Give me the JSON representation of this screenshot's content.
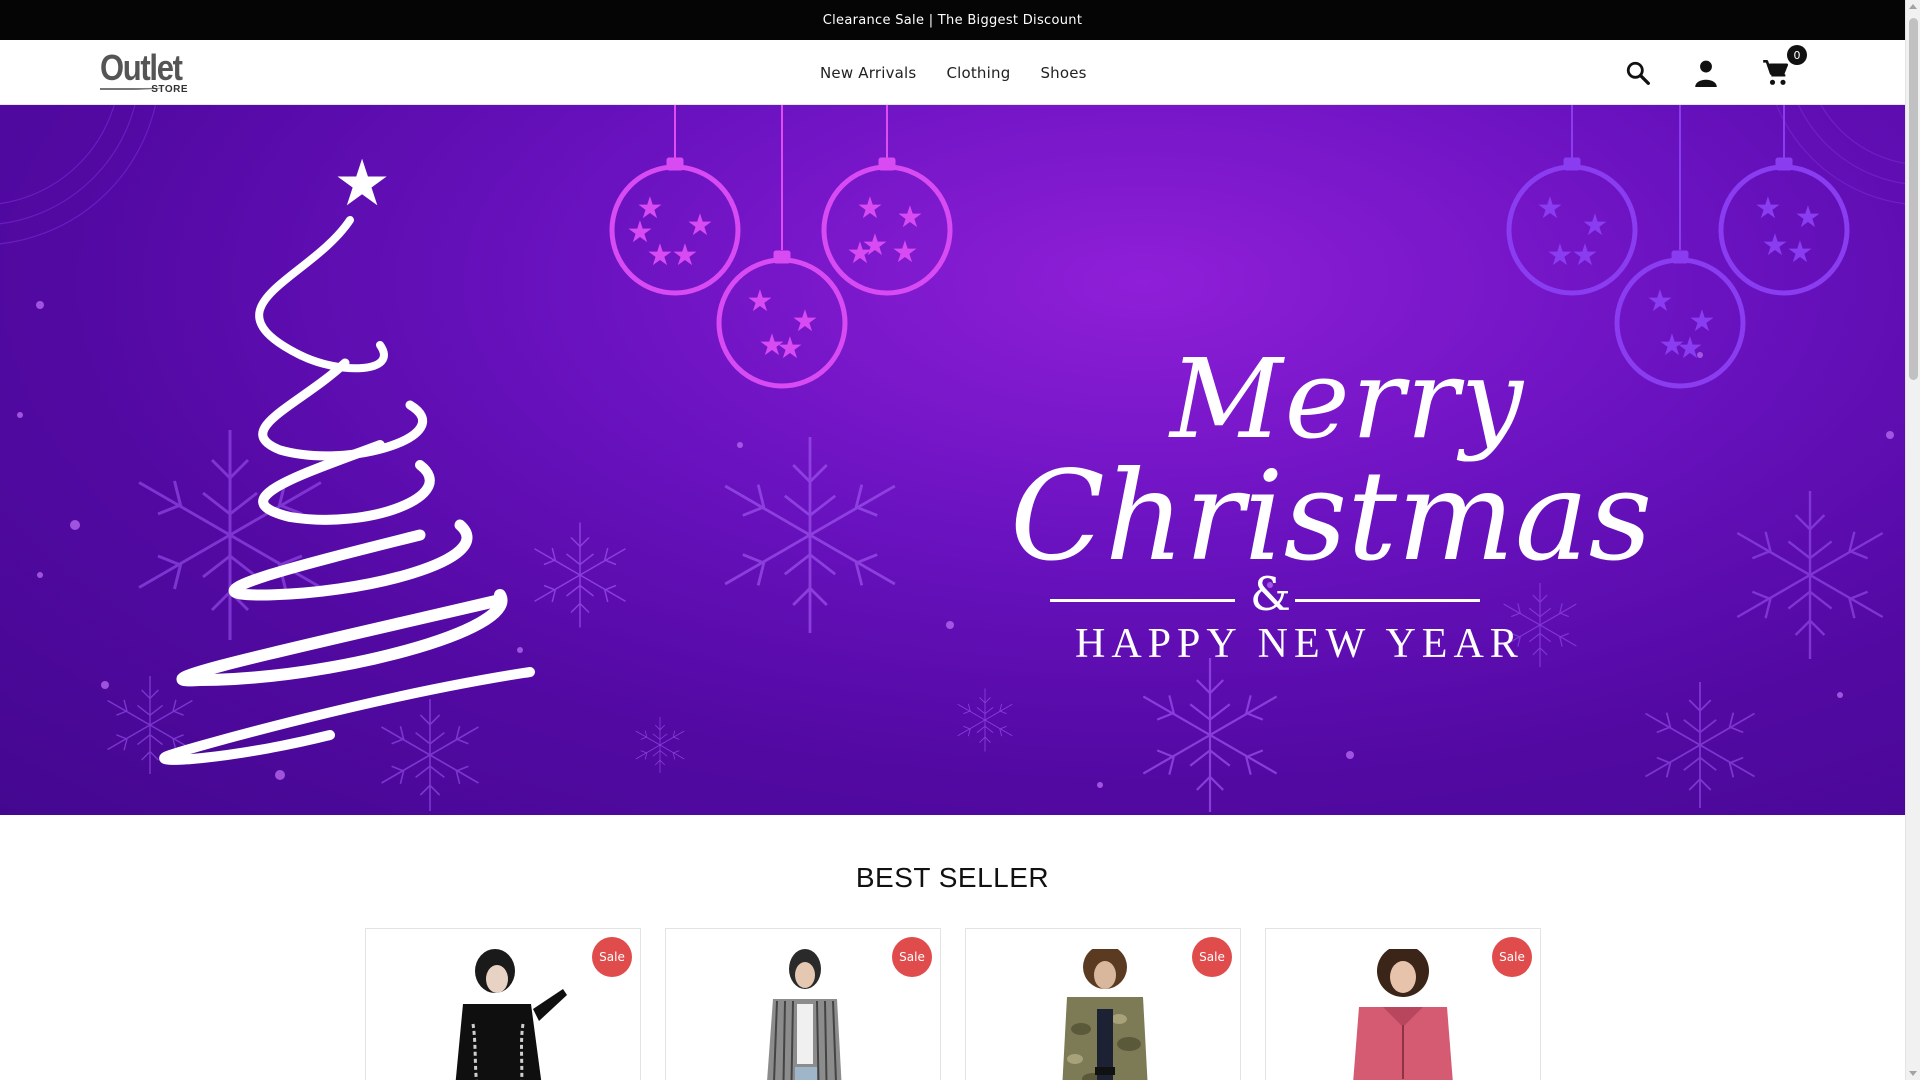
{
  "announcement": {
    "text": "Clearance Sale | The Biggest Discount"
  },
  "header": {
    "logo": {
      "main": "Outlet",
      "sub": "STORE"
    },
    "nav": [
      "New Arrivals",
      "Clothing",
      "Shoes"
    ],
    "icons": [
      "search-icon",
      "account-icon",
      "cart-icon"
    ],
    "cart_count": "0"
  },
  "hero": {
    "line1": "Merry",
    "line2": "Christmas",
    "ampersand": "&",
    "line3": "HAPPY NEW YEAR",
    "colors": {
      "bg_top": "#8f1fd8",
      "bg_bottom": "#440890",
      "ornament_pink": "#d649f2",
      "ornament_purple": "#8a3cf0"
    }
  },
  "best_seller": {
    "title": "BEST SELLER",
    "products": [
      {
        "badge": "Sale"
      },
      {
        "badge": "Sale"
      },
      {
        "badge": "Sale"
      },
      {
        "badge": "Sale"
      }
    ]
  },
  "colors": {
    "sale_badge": "#e04b4b",
    "announce_bg": "#050505"
  }
}
